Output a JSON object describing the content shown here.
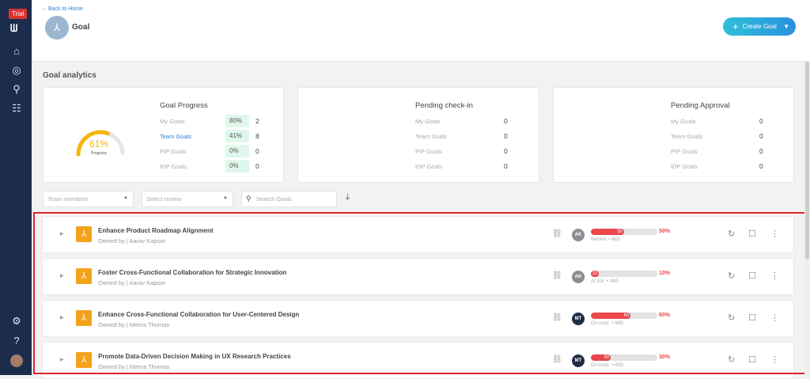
{
  "sidebar": {
    "trial": "Trial",
    "logo": "W",
    "icons": [
      "home-icon",
      "target-icon",
      "user-run-icon",
      "team-icon",
      "settings-icon",
      "help-icon"
    ]
  },
  "header": {
    "back": "← Back to Home",
    "title": "Goal",
    "create": "Create Goal"
  },
  "section_title": "Goal analytics",
  "goal_progress": {
    "title": "Goal Progress",
    "gauge_value": "61%",
    "gauge_percent": 61,
    "gauge_label": "Progress",
    "rows": [
      {
        "label": "My Goals",
        "pct": "80%",
        "count": "2"
      },
      {
        "label": "Team Goals",
        "pct": "41%",
        "count": "8"
      },
      {
        "label": "PIP Goals",
        "pct": "0%",
        "count": "0"
      },
      {
        "label": "IDP Goals",
        "pct": "0%",
        "count": "0"
      }
    ]
  },
  "pending_checkin": {
    "title": "Pending check-in",
    "rows": [
      {
        "label": "My Goals",
        "count": "0"
      },
      {
        "label": "Team Goals",
        "count": "0"
      },
      {
        "label": "PIP Goals",
        "count": "0"
      },
      {
        "label": "IDP Goals",
        "count": "0"
      }
    ]
  },
  "pending_approval": {
    "title": "Pending Approval",
    "rows": [
      {
        "label": "My Goals",
        "count": "0"
      },
      {
        "label": "Team Goals",
        "count": "0"
      },
      {
        "label": "PIP Goals",
        "count": "0"
      },
      {
        "label": "IDP Goals",
        "count": "0"
      }
    ]
  },
  "filters": {
    "team_members": "Team members",
    "select_review": "Select review",
    "search_placeholder": "Search Goals"
  },
  "colors": {
    "sidebar": "#1c2c4c",
    "accent": "#2a8fe0",
    "progress": "#e9474b",
    "gauge": "#f5b50a",
    "highlight": "#d8262c"
  },
  "goals": [
    {
      "title": "Enhance Product Roadmap Alignment",
      "owner": "Owned by | Aarav Kapoor",
      "initials": "AK",
      "progress": 50,
      "bar_label": "50",
      "pct": "50%",
      "status": "Behind",
      "days": "• 48D",
      "avatar_color": "#8a8f93"
    },
    {
      "title": "Foster Cross-Functional Collaboration for Strategic Innovation",
      "owner": "Owned by | Aarav Kapoor",
      "initials": "AK",
      "progress": 10,
      "bar_label": "10",
      "pct": "10%",
      "status": "At risk",
      "days": "• 48D",
      "avatar_color": "#8a8f93"
    },
    {
      "title": "Enhance Cross-Functional Collaboration for User-Centered Design",
      "owner": "Owned by | Meera Thomas",
      "initials": "MT",
      "progress": 60,
      "bar_label": "60",
      "pct": "60%",
      "status": "On-track",
      "days": "• 48D",
      "avatar_color": "#1f2d45"
    },
    {
      "title": "Promote Data-Driven Decision Making in UX Research Practices",
      "owner": "Owned by | Meera Thomas",
      "initials": "MT",
      "progress": 30,
      "bar_label": "30",
      "pct": "30%",
      "status": "On-track",
      "days": "• 48D",
      "avatar_color": "#1f2d45"
    }
  ]
}
